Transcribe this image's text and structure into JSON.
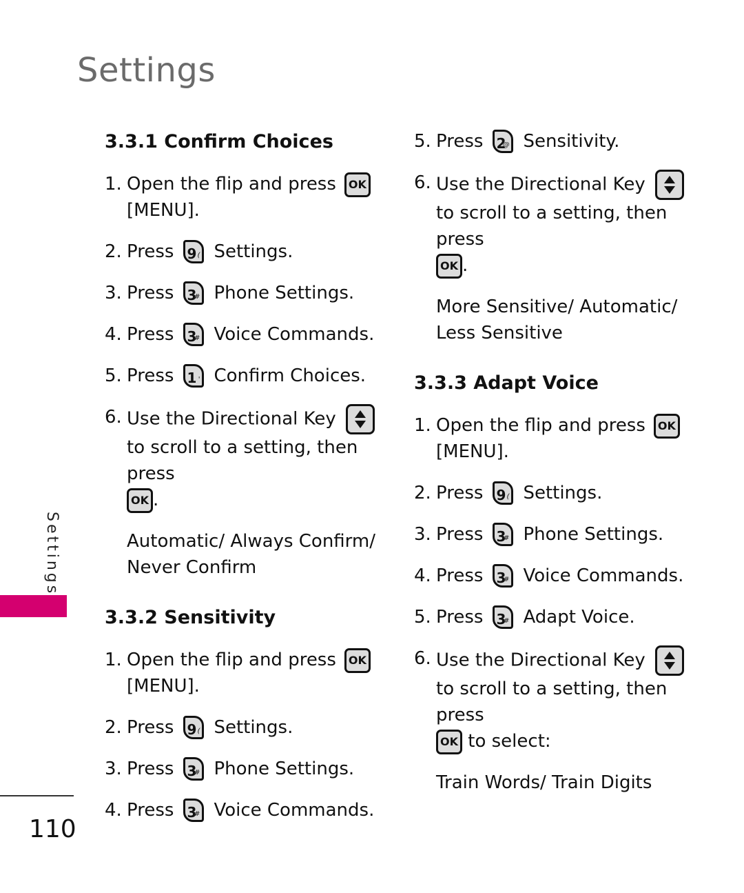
{
  "page": {
    "title": "Settings",
    "side_label": "Settings",
    "page_number": "110",
    "accent_color": "#d4006f"
  },
  "keys": {
    "ok": "OK"
  },
  "sections": [
    {
      "heading": "3.3.1 Confirm Choices",
      "step1": {
        "num": "1.",
        "text": "Open the flip and press",
        "menu": "[MENU]."
      },
      "press_steps": [
        {
          "num": "2.",
          "word": "Press",
          "key_digit": "9",
          "key_sup": "(",
          "target": "Settings."
        },
        {
          "num": "3.",
          "word": "Press",
          "key_digit": "3",
          "key_sup": "#",
          "target": "Phone Settings."
        },
        {
          "num": "4.",
          "word": "Press",
          "key_digit": "3",
          "key_sup": "#",
          "target": "Voice Commands."
        },
        {
          "num": "5.",
          "word": "Press",
          "key_digit": "1",
          "key_sup": "'",
          "target": "Confirm Choices."
        }
      ],
      "step6": {
        "num": "6.",
        "text1": "Use the Directional Key",
        "text2": "to scroll to a setting, then press",
        "tail": "."
      },
      "options": [
        "Automatic/ Always Confirm/",
        "Never Confirm"
      ]
    },
    {
      "heading": "3.3.2 Sensitivity",
      "step1": {
        "num": "1.",
        "text": "Open the flip and press",
        "menu": "[MENU]."
      },
      "press_steps": [
        {
          "num": "2.",
          "word": "Press",
          "key_digit": "9",
          "key_sup": "(",
          "target": "Settings."
        },
        {
          "num": "3.",
          "word": "Press",
          "key_digit": "3",
          "key_sup": "#",
          "target": "Phone Settings."
        },
        {
          "num": "4.",
          "word": "Press",
          "key_digit": "3",
          "key_sup": "#",
          "target": "Voice Commands."
        },
        {
          "num": "5.",
          "word": "Press",
          "key_digit": "2",
          "key_sup": "@",
          "target": "Sensitivity."
        }
      ],
      "step6": {
        "num": "6.",
        "text1": "Use the Directional Key",
        "text2": "to scroll to a setting, then press",
        "tail": "."
      },
      "options": [
        "More Sensitive/ Automatic/",
        "Less Sensitive"
      ]
    },
    {
      "heading": "3.3.3 Adapt Voice",
      "step1": {
        "num": "1.",
        "text": "Open the flip and press",
        "menu": "[MENU]."
      },
      "press_steps": [
        {
          "num": "2.",
          "word": "Press",
          "key_digit": "9",
          "key_sup": "(",
          "target": "Settings."
        },
        {
          "num": "3.",
          "word": "Press",
          "key_digit": "3",
          "key_sup": "#",
          "target": "Phone Settings."
        },
        {
          "num": "4.",
          "word": "Press",
          "key_digit": "3",
          "key_sup": "#",
          "target": "Voice Commands."
        },
        {
          "num": "5.",
          "word": "Press",
          "key_digit": "3",
          "key_sup": "#",
          "target": "Adapt Voice."
        }
      ],
      "step6": {
        "num": "6.",
        "text1": "Use the Directional Key",
        "text2": "to scroll to a setting, then press",
        "tail": " to select:"
      },
      "options": [
        "Train Words/ Train Digits"
      ]
    }
  ]
}
